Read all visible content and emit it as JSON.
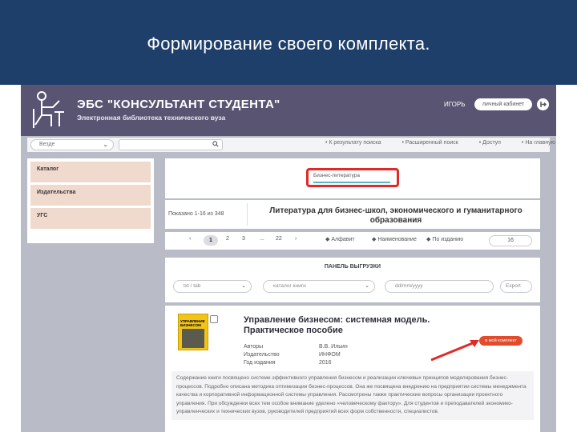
{
  "slide": {
    "title": "Формирование своего комплекта."
  },
  "site": {
    "name": "ЭБС \"КОНСУЛЬТАНТ СТУДЕНТА\"",
    "subtitle": "Электронная библиотека технического вуза",
    "user": "ИГОРЬ",
    "cabinet_label": "личный кабинет",
    "header_color": "#585472"
  },
  "search": {
    "scope_value": "Везде",
    "input_value": "",
    "nav_links": [
      "К результату поиска",
      "Расширенный поиск",
      "Доступ",
      "На главную"
    ]
  },
  "sidebar": {
    "items": [
      {
        "label": "Каталог"
      },
      {
        "label": "Издательства"
      },
      {
        "label": "УГС"
      }
    ]
  },
  "collection": {
    "tag": "Бизнес-литература",
    "shown": "Показано 1-16 из 348",
    "title": "Литература для бизнес-школ, экономического и гуманитарного образования"
  },
  "pager": {
    "prev": "‹",
    "pages": [
      "1",
      "2",
      "3",
      "...",
      "22"
    ],
    "next": "›",
    "sort_links": [
      "Алфавит",
      "Наименование",
      "По изданию"
    ],
    "per_page": "16"
  },
  "export": {
    "title": "ПАНЕЛЬ ВЫГРУЗКИ",
    "format": "txt / tab",
    "type": "каталог книги",
    "date_placeholder": "dd/mm/yyyy",
    "button": "Export"
  },
  "book": {
    "cover_text": "УПРАВЛЕНИЕ БИЗНЕСОМ",
    "title": "Управление бизнесом: системная модель. Практическое пособие",
    "authors_label": "Авторы",
    "authors_value": "В.В. Ильин",
    "publisher_label": "Издательство",
    "publisher_value": "ИНФОМ",
    "year_label": "Год издания",
    "year_value": "2016",
    "add_button": "в мой комплект",
    "description": "Содержание книги посвящено системе эффективного управления бизнесом и реализации ключевых принципов моделирования бизнес-процессов. Подробно описана методика оптимизации бизнес-процессов. Она же посвящена внедрению на предприятии системы менеджмента качества и корпоративной информационной системы управления. Рассмотрены также практические вопросы организации проектного управления. При обсуждении всех тем особое внимание уделено «человеческому фактору». Для студентов и преподавателей экономико-управленческих и технических вузов, руководителей предприятий всех форм собственности, специалистов."
  },
  "colors": {
    "slide_header": "#1f3f6b",
    "highlight_red": "#e02a2a",
    "sidebar_item": "#f0d9cd",
    "add_button": "#e24b2b"
  }
}
